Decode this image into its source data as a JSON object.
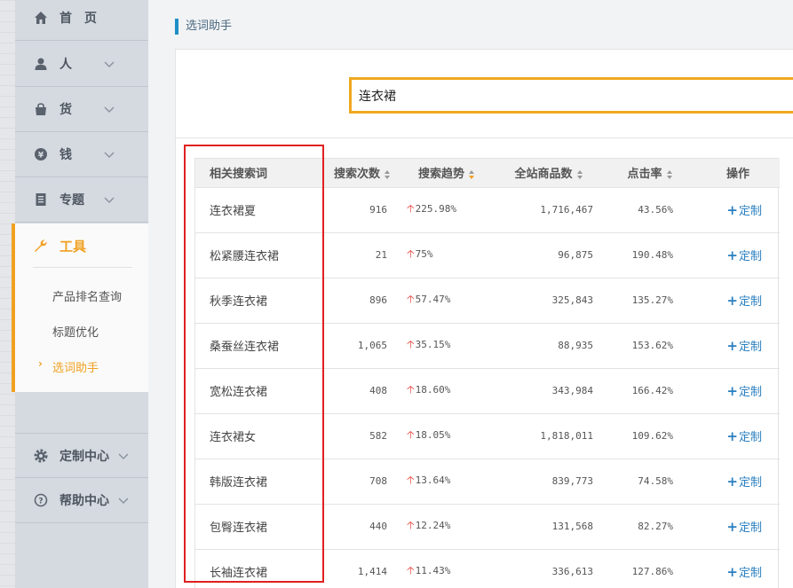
{
  "sidebar": {
    "items": [
      {
        "label": "首　页"
      },
      {
        "label": "人"
      },
      {
        "label": "货"
      },
      {
        "label": "钱"
      },
      {
        "label": "专题"
      },
      {
        "label": "工具"
      },
      {
        "label": "定制中心"
      },
      {
        "label": "帮助中心"
      }
    ],
    "tools_sub": [
      {
        "label": "产品排名查询"
      },
      {
        "label": "标题优化"
      },
      {
        "label": "选词助手"
      }
    ],
    "active_arrow": "›"
  },
  "page": {
    "title": "选词助手"
  },
  "search": {
    "value": "连衣裙"
  },
  "table": {
    "headers": [
      "相关搜索词",
      "搜索次数",
      "搜索趋势",
      "全站商品数",
      "点击率",
      "操作"
    ],
    "action_label": "定制",
    "rows": [
      {
        "keyword": "连衣裙夏",
        "searches": "916",
        "trend": "225.98%",
        "products": "1,716,467",
        "ctr": "43.56%"
      },
      {
        "keyword": "松紧腰连衣裙",
        "searches": "21",
        "trend": "75%",
        "products": "96,875",
        "ctr": "190.48%"
      },
      {
        "keyword": "秋季连衣裙",
        "searches": "896",
        "trend": "57.47%",
        "products": "325,843",
        "ctr": "135.27%"
      },
      {
        "keyword": "桑蚕丝连衣裙",
        "searches": "1,065",
        "trend": "35.15%",
        "products": "88,935",
        "ctr": "153.62%"
      },
      {
        "keyword": "宽松连衣裙",
        "searches": "408",
        "trend": "18.60%",
        "products": "343,984",
        "ctr": "166.42%"
      },
      {
        "keyword": "连衣裙女",
        "searches": "582",
        "trend": "18.05%",
        "products": "1,818,011",
        "ctr": "109.62%"
      },
      {
        "keyword": "韩版连衣裙",
        "searches": "708",
        "trend": "13.64%",
        "products": "839,773",
        "ctr": "74.58%"
      },
      {
        "keyword": "包臀连衣裙",
        "searches": "440",
        "trend": "12.24%",
        "products": "131,568",
        "ctr": "82.27%"
      },
      {
        "keyword": "长袖连衣裙",
        "searches": "1,414",
        "trend": "11.43%",
        "products": "336,613",
        "ctr": "127.86%"
      }
    ]
  },
  "colors": {
    "accent": "#f0a020",
    "link": "#2a7fc0",
    "trend_up": "#e8423a",
    "highlight_box": "#e02020"
  }
}
